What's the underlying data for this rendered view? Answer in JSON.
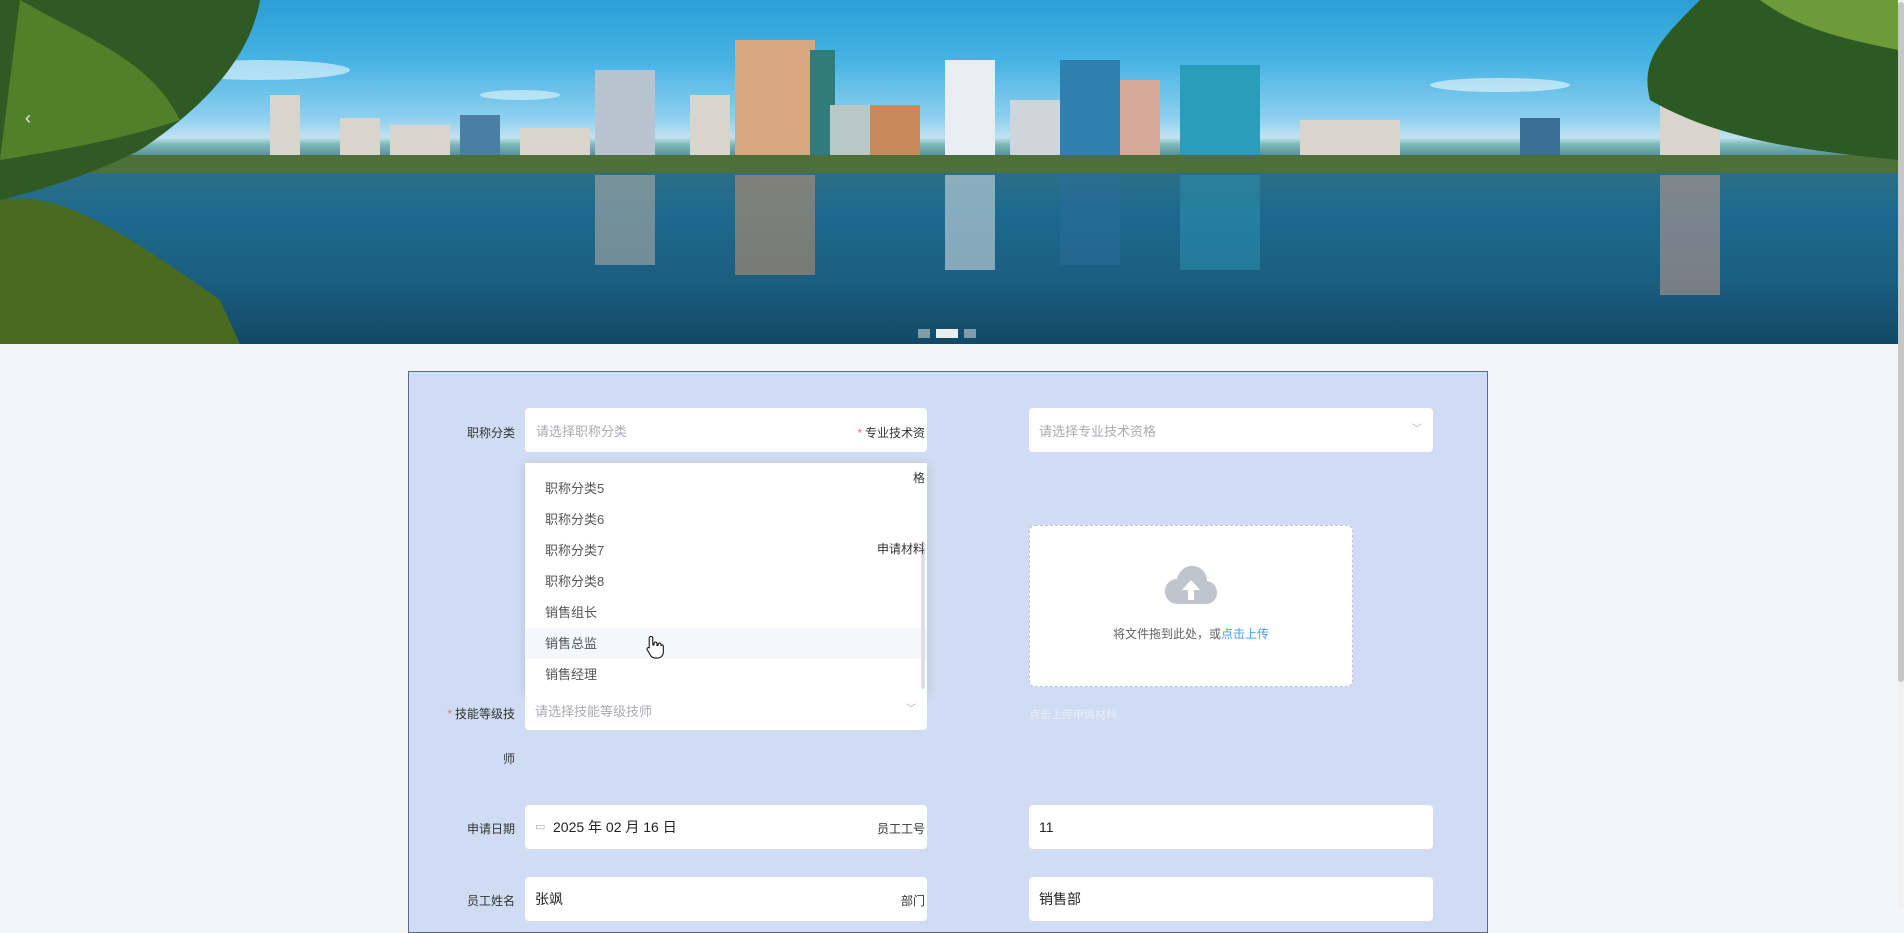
{
  "banner": {
    "prev_arrow": "‹",
    "dots": 3,
    "active_dot": 1
  },
  "form": {
    "title_category": {
      "label": "职称分类",
      "placeholder": "请选择职称分类",
      "options_visible": [
        "职称分类5",
        "职称分类6",
        "职称分类7",
        "职称分类8",
        "销售组长",
        "销售总监",
        "销售经理"
      ],
      "hovered_option": "销售总监"
    },
    "qualification": {
      "label_line1": "专业技术资",
      "label_line2": "格",
      "placeholder": "请选择专业技术资格"
    },
    "materials": {
      "label": "申请材料",
      "drop_text": "将文件拖到此处，或",
      "click_text": "点击上传",
      "tip": "点击上传申请材料"
    },
    "skill_level": {
      "label_line1": "技能等级技",
      "label_line2": "师",
      "placeholder": "请选择技能等级技师"
    },
    "apply_date": {
      "label": "申请日期",
      "value": "2025 年 02 月 16 日"
    },
    "employee_id": {
      "label": "员工工号",
      "value": "11"
    },
    "employee_name": {
      "label": "员工姓名",
      "value": "张飒"
    },
    "department": {
      "label": "部门",
      "value": "销售部"
    }
  },
  "colors": {
    "panel_bg": "#cfdcf3",
    "required": "#f56c6c",
    "link": "#409eff"
  }
}
